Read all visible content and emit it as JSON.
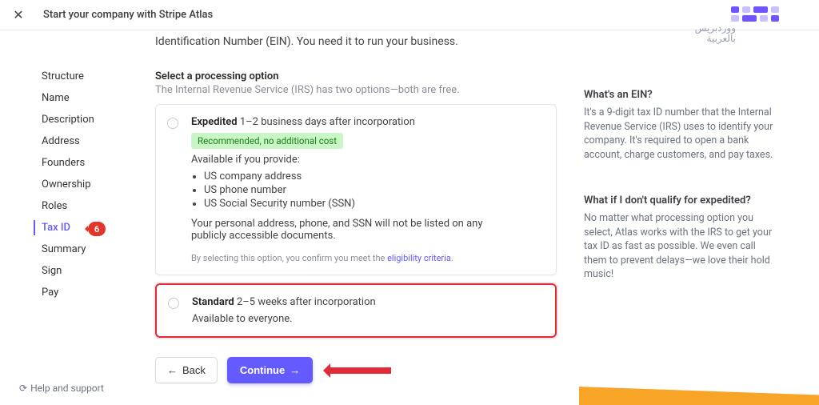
{
  "colors": {
    "accent": "#635bff",
    "danger": "#e22b36"
  },
  "header": {
    "close_icon": "✕",
    "title": "Start your company with Stripe Atlas"
  },
  "sidebar": {
    "items": [
      {
        "label": "Structure"
      },
      {
        "label": "Name"
      },
      {
        "label": "Description"
      },
      {
        "label": "Address"
      },
      {
        "label": "Founders"
      },
      {
        "label": "Ownership"
      },
      {
        "label": "Roles"
      },
      {
        "label": "Tax ID",
        "active": true,
        "badge": "6"
      },
      {
        "label": "Summary"
      },
      {
        "label": "Sign"
      },
      {
        "label": "Pay"
      }
    ],
    "help_label": "Help and support",
    "help_icon": "⟳"
  },
  "main": {
    "intro": "Identification Number (EIN). You need it to run your business.",
    "section_title": "Select a processing option",
    "section_subtitle": "The Internal Revenue Service (IRS) has two options—both are free.",
    "option_expedited": {
      "name": "Expedited",
      "timing": "1–2 business days after incorporation",
      "pill": "Recommended, no additional cost",
      "available_label": "Available if you provide:",
      "reqs": [
        "US company address",
        "US phone number",
        "US Social Security number (SSN)"
      ],
      "note": "Your personal address, phone, and SSN will not be listed on any publicly accessible documents.",
      "fine_prefix": "By selecting this option, you confirm you meet the ",
      "fine_link": "eligibility criteria",
      "fine_suffix": "."
    },
    "option_standard": {
      "name": "Standard",
      "timing": "2–5 weeks after incorporation",
      "note": "Available to everyone."
    },
    "back_label": "Back",
    "continue_label": "Continue"
  },
  "right_rail": {
    "logo_line1": "ووردبريس",
    "logo_line2": "بالعربية",
    "q1_title": "What's an EIN?",
    "q1_body": "It's a 9-digit tax ID number that the Internal Revenue Service (IRS) uses to identify your company. It's required to open a bank account, charge customers, and pay taxes.",
    "q2_title": "What if I don't qualify for expedited?",
    "q2_body": "No matter what processing option you select, Atlas works with the IRS to get your tax ID as fast as possible. We even call them to prevent delays—we love their hold music!"
  }
}
